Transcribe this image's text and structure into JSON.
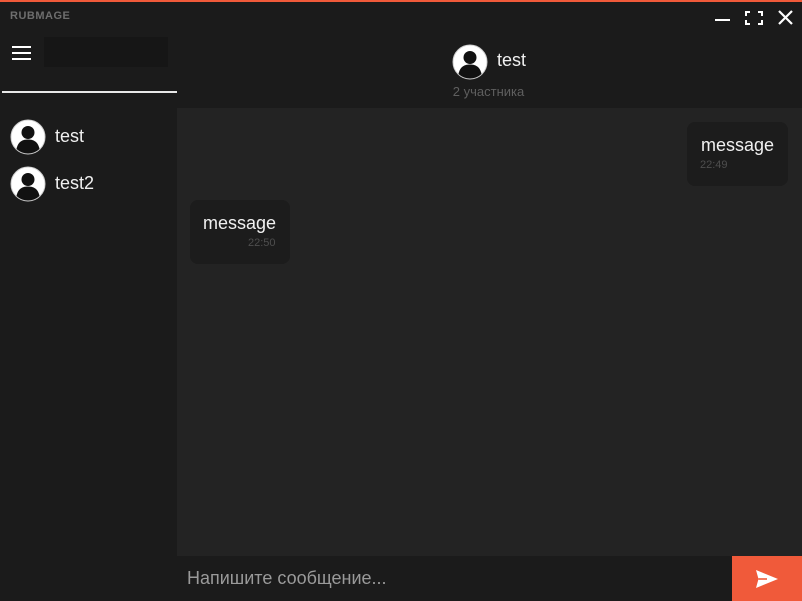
{
  "app": {
    "title": "RUBMAGE",
    "accent": "#f05a3a"
  },
  "window_controls": {
    "minimize_icon": "minimize-icon",
    "maximize_icon": "maximize-icon",
    "close_icon": "close-icon"
  },
  "sidebar": {
    "menu_icon": "hamburger-menu-icon",
    "search": {
      "value": "",
      "placeholder": ""
    },
    "chats": [
      {
        "name": "test",
        "avatar": "user-avatar-icon"
      },
      {
        "name": "test2",
        "avatar": "user-avatar-icon"
      }
    ]
  },
  "header": {
    "name": "test",
    "members": "2 участника"
  },
  "messages": [
    {
      "direction": "outgoing",
      "text": "message",
      "time": "22:49"
    },
    {
      "direction": "incoming",
      "text": "message",
      "time": "22:50"
    }
  ],
  "composer": {
    "placeholder": "Напишите сообщение...",
    "value": "",
    "send_icon": "send-icon"
  }
}
